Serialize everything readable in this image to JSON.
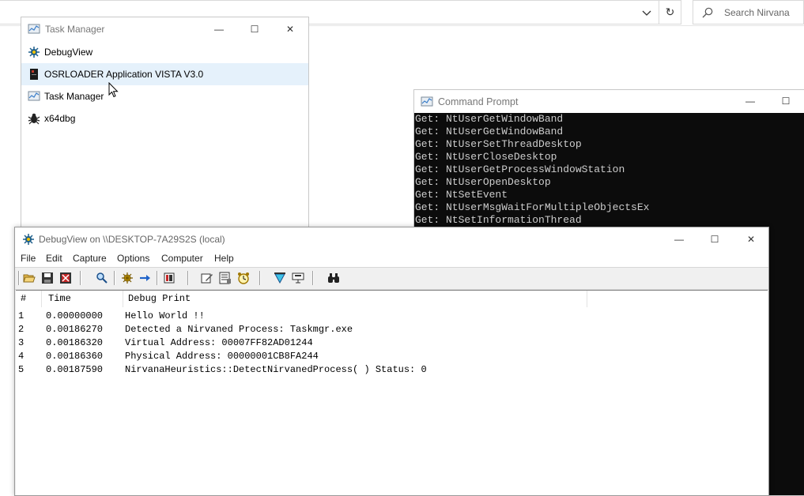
{
  "explorer": {
    "search_placeholder": "Search Nirvana",
    "refresh_glyph": "↻",
    "dropdown_glyph": "⌵"
  },
  "task_manager": {
    "title": "Task Manager",
    "items": [
      {
        "label": "DebugView",
        "icon": "debugview-icon",
        "selected": false
      },
      {
        "label": "OSRLOADER Application VISTA V3.0",
        "icon": "osrloader-icon",
        "selected": true
      },
      {
        "label": "Task Manager",
        "icon": "task-manager-icon",
        "selected": false
      },
      {
        "label": "x64dbg",
        "icon": "x64dbg-bug-icon",
        "selected": false
      }
    ]
  },
  "command_prompt": {
    "title": "Command Prompt",
    "lines": [
      "Get: NtUserGetWindowBand",
      "Get: NtUserGetWindowBand",
      "Get: NtUserSetThreadDesktop",
      "Get: NtUserCloseDesktop",
      "Get: NtUserGetProcessWindowStation",
      "Get: NtUserOpenDesktop",
      "Get: NtSetEvent",
      "Get: NtUserMsgWaitForMultipleObjectsEx",
      "Get: NtSetInformationThread"
    ]
  },
  "debugview": {
    "title": "DebugView on \\\\DESKTOP-7A29S2S (local)",
    "menu": [
      "File",
      "Edit",
      "Capture",
      "Options",
      "Computer",
      "Help"
    ],
    "columns": [
      "#",
      "Time",
      "Debug Print"
    ],
    "rows": [
      {
        "num": "1",
        "time": "0.00000000",
        "text": "Hello World !!"
      },
      {
        "num": "2",
        "time": "0.00186270",
        "text": "Detected a Nirvaned Process: Taskmgr.exe"
      },
      {
        "num": "3",
        "time": "0.00186320",
        "text": "Virtual Address: 00007FF82AD01244"
      },
      {
        "num": "4",
        "time": "0.00186360",
        "text": "Physical Address: 00000001CB8FA244"
      },
      {
        "num": "5",
        "time": "0.00187590",
        "text": "NirvanaHeuristics::DetectNirvanedProcess( ) Status: 0"
      }
    ]
  },
  "window_controls": {
    "minimize": "—",
    "maximize": "☐",
    "close": "✕"
  },
  "colors": {
    "selection": "#e5f1fb",
    "console_bg": "#0c0c0c",
    "console_fg": "#cccccc"
  }
}
